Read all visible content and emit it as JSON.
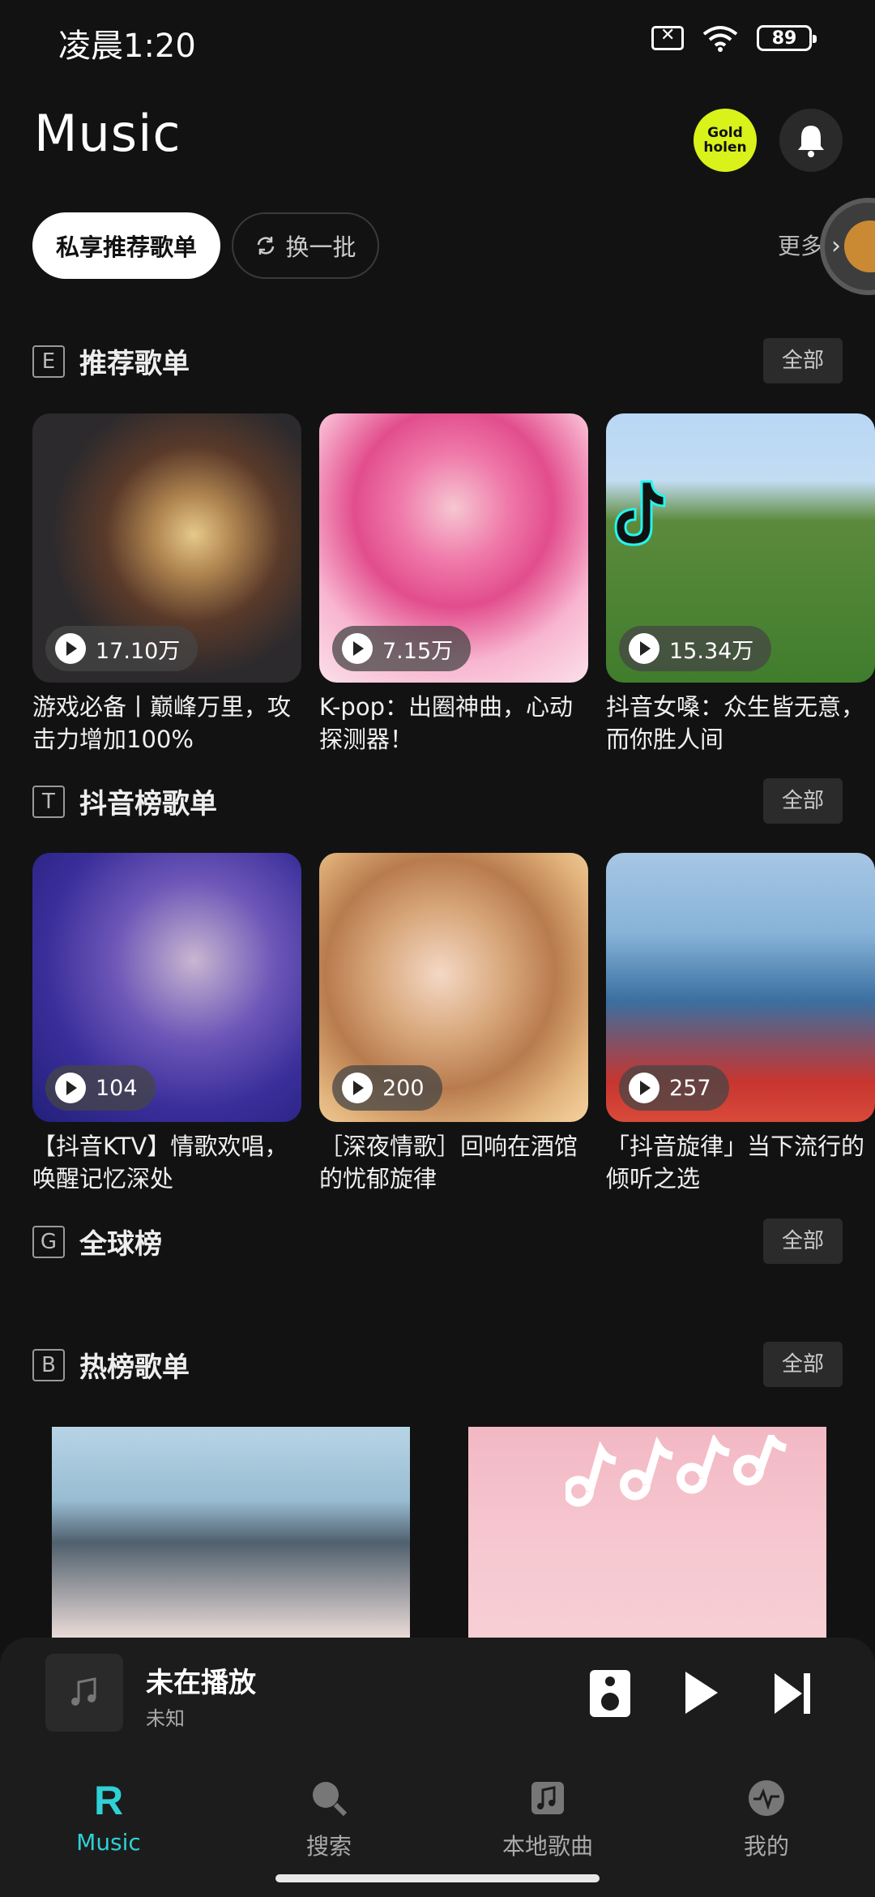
{
  "status_bar": {
    "time": "凌晨1:20",
    "battery": "89"
  },
  "header": {
    "title": "Music",
    "badge_text": "Gold holen"
  },
  "chips": {
    "active": "私享推荐歌单",
    "refresh": "换一批",
    "more": "更多"
  },
  "sections": [
    {
      "letter": "E",
      "title": "推荐歌单",
      "all": "全部",
      "cards": [
        {
          "count": "17.10万",
          "title": "游戏必备丨巅峰万里，攻击力增加100%"
        },
        {
          "count": "7.15万",
          "title": "K-pop：出圈神曲，心动探测器！"
        },
        {
          "count": "15.34万",
          "title": "抖音女嗓：众生皆无意，而你胜人间"
        }
      ]
    },
    {
      "letter": "T",
      "title": "抖音榜歌单",
      "all": "全部",
      "cards": [
        {
          "count": "104",
          "title": "【抖音KTV】情歌欢唱，唤醒记忆深处"
        },
        {
          "count": "200",
          "title": "［深夜情歌］回响在酒馆的忧郁旋律"
        },
        {
          "count": "257",
          "title": "「抖音旋律」当下流行的倾听之选"
        }
      ]
    },
    {
      "letter": "G",
      "title": "全球榜",
      "all": "全部"
    },
    {
      "letter": "B",
      "title": "热榜歌单",
      "all": "全部"
    }
  ],
  "player": {
    "title": "未在播放",
    "artist": "未知"
  },
  "nav": [
    {
      "label": "Music",
      "icon": "r-logo-icon",
      "active": true
    },
    {
      "label": "搜索",
      "icon": "search-icon"
    },
    {
      "label": "本地歌曲",
      "icon": "music-note-icon"
    },
    {
      "label": "我的",
      "icon": "activity-icon"
    }
  ],
  "colors": {
    "accent": "#2fd0d6",
    "badge": "#d8f21a",
    "background": "#121212"
  }
}
